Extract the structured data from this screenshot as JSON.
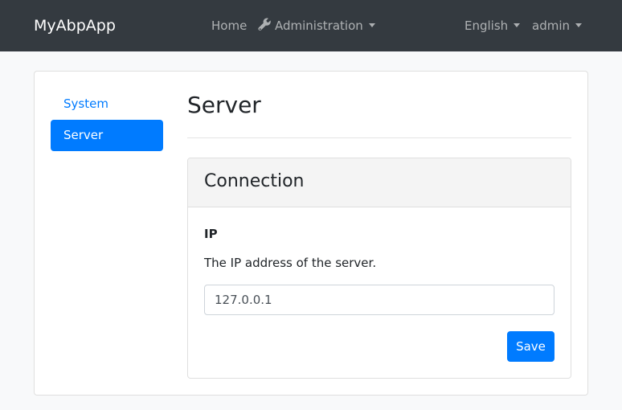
{
  "navbar": {
    "brand": "MyAbpApp",
    "home": "Home",
    "administration": "Administration",
    "language": "English",
    "user": "admin"
  },
  "sidebar": {
    "items": [
      {
        "label": "System",
        "active": false
      },
      {
        "label": "Server",
        "active": true
      }
    ]
  },
  "main": {
    "title": "Server",
    "group": {
      "title": "Connection",
      "field": {
        "label": "IP",
        "description": "The IP address of the server.",
        "value": "127.0.0.1"
      },
      "save_label": "Save"
    }
  },
  "colors": {
    "navbar_bg": "#343a40",
    "accent": "#007bff",
    "page_bg": "#f8f9fa"
  },
  "icons": {
    "administration": "wrench-icon",
    "dropdown": "caret-down-icon"
  }
}
